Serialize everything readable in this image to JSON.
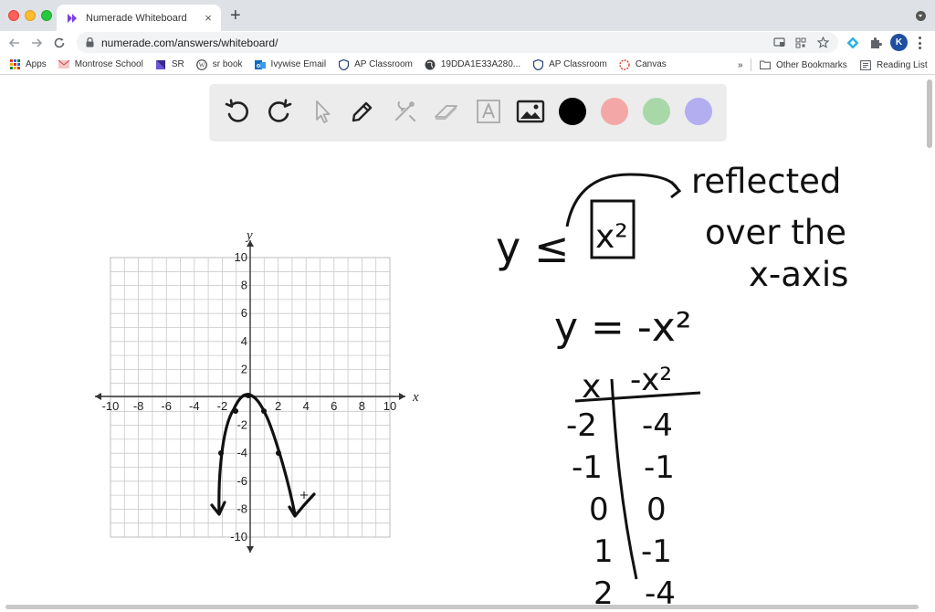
{
  "browser": {
    "tab_title": "Numerade Whiteboard",
    "tab_close": "×",
    "new_tab": "+",
    "url": "numerade.com/answers/whiteboard/",
    "profile_initial": "K"
  },
  "bookmarks": {
    "items": [
      {
        "label": "Apps",
        "icon": "apps-grid-icon"
      },
      {
        "label": "Montrose School",
        "icon": "montrose-icon"
      },
      {
        "label": "SR",
        "icon": "sr-flag-icon"
      },
      {
        "label": "sr book",
        "icon": "wordpress-icon"
      },
      {
        "label": "Ivywise Email",
        "icon": "outlook-icon"
      },
      {
        "label": "AP Classroom",
        "icon": "shield-icon"
      },
      {
        "label": "19DDA1E33A280...",
        "icon": "globe-icon"
      },
      {
        "label": "AP Classroom",
        "icon": "shield-icon"
      },
      {
        "label": "Canvas",
        "icon": "canvas-icon"
      }
    ],
    "overflow": "»",
    "other_bookmarks": "Other Bookmarks",
    "reading_list": "Reading List"
  },
  "whiteboard": {
    "tools": [
      "undo-icon",
      "redo-icon",
      "pointer-icon",
      "pen-icon",
      "tools-icon",
      "eraser-icon",
      "text-icon",
      "image-icon"
    ],
    "colors": [
      "#000000",
      "#f4a7a7",
      "#a8d8a8",
      "#b3aef0"
    ],
    "graph": {
      "x_axis_label": "x",
      "y_axis_label": "y",
      "x_ticks": [
        "-10",
        "-8",
        "-6",
        "-4",
        "-2",
        "2",
        "4",
        "6",
        "8",
        "10"
      ],
      "y_ticks": [
        "10",
        "8",
        "6",
        "4",
        "2",
        "-2",
        "-4",
        "-6",
        "-8",
        "-10"
      ]
    },
    "handwriting": {
      "inequality": "y ≤",
      "boxed_term": "x²",
      "note_line1": "reflected",
      "note_line2": "over the",
      "note_line3": "x-axis",
      "equation": "y = -x²",
      "table_header_x": "x",
      "table_header_y": "-x²",
      "table_x": [
        "-2",
        "-1",
        "0",
        "1",
        "2"
      ],
      "table_y": [
        "-4",
        "-1",
        "0",
        "-1",
        "-4"
      ]
    }
  }
}
